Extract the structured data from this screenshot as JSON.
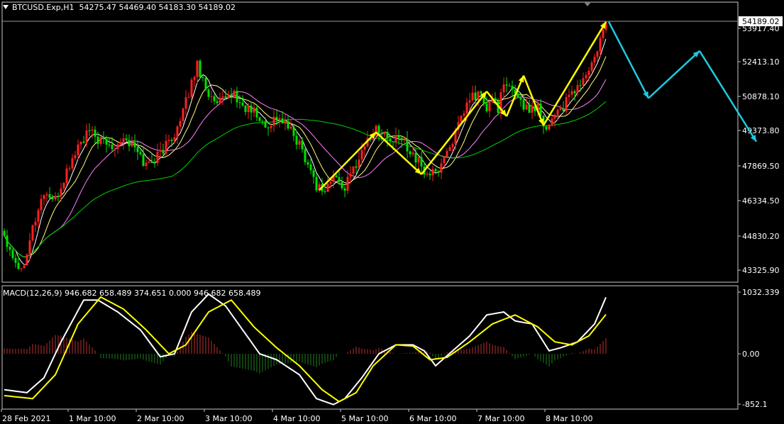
{
  "header": {
    "symbol": "BTCUSD.Exp,H1",
    "ohlc": "54275.47 54469.40 54183.30 54189.02"
  },
  "macd_header": {
    "text": "MACD(12,26,9) 946.682 658.489 374.651 0.000 946.682 658.489"
  },
  "price_axis": {
    "ticks": [
      53917.4,
      52413.1,
      50878.1,
      49373.8,
      47869.5,
      46334.5,
      44830.2,
      43325.9
    ],
    "tick_labels": [
      "53917.40",
      "52413.10",
      "50878.10",
      "49373.80",
      "47869.50",
      "46334.50",
      "44830.20",
      "43325.90"
    ],
    "current_price_label": "54189.02"
  },
  "macd_axis": {
    "tick_labels": [
      "1032.339",
      "0.00",
      "-852.1"
    ]
  },
  "time_axis": {
    "labels": [
      "28 Feb 2021",
      "1 Mar 10:00",
      "2 Mar 10:00",
      "3 Mar 10:00",
      "4 Mar 10:00",
      "5 Mar 10:00",
      "6 Mar 10:00",
      "7 Mar 10:00",
      "8 Mar 10:00"
    ]
  },
  "colors": {
    "background": "#000000",
    "bull": "#ff2020",
    "bear": "#00e000",
    "ma_fast": "#ffffff",
    "ma_mid": "#ffff80",
    "ma_slow": "#ff80ff",
    "ma_long": "#00d000",
    "zigzag": "#ffff00",
    "forecast": "#20c8e0",
    "macd_line": "#ffffff",
    "signal_line": "#ffff00",
    "hist_pos": "#c03030",
    "hist_neg": "#208020"
  },
  "chart_data": {
    "type": "candlestick",
    "symbol": "BTCUSD.Exp",
    "timeframe": "H1",
    "ylim": [
      42600,
      55000
    ],
    "close_path": [
      [
        0,
        44900
      ],
      [
        3,
        44000
      ],
      [
        6,
        43300
      ],
      [
        10,
        45200
      ],
      [
        14,
        46700
      ],
      [
        18,
        46300
      ],
      [
        22,
        47600
      ],
      [
        26,
        48700
      ],
      [
        30,
        49300
      ],
      [
        34,
        48900
      ],
      [
        38,
        48700
      ],
      [
        42,
        49100
      ],
      [
        46,
        48600
      ],
      [
        50,
        47900
      ],
      [
        54,
        48300
      ],
      [
        58,
        48900
      ],
      [
        62,
        49700
      ],
      [
        66,
        51500
      ],
      [
        68,
        52300
      ],
      [
        71,
        51300
      ],
      [
        74,
        50500
      ],
      [
        78,
        50700
      ],
      [
        80,
        51100
      ],
      [
        84,
        50400
      ],
      [
        88,
        50200
      ],
      [
        92,
        49500
      ],
      [
        96,
        50000
      ],
      [
        100,
        49500
      ],
      [
        104,
        48800
      ],
      [
        107,
        48000
      ],
      [
        110,
        47000
      ],
      [
        113,
        46800
      ],
      [
        116,
        47400
      ],
      [
        120,
        46900
      ],
      [
        124,
        48000
      ],
      [
        128,
        49000
      ],
      [
        132,
        49500
      ],
      [
        136,
        48900
      ],
      [
        140,
        49000
      ],
      [
        144,
        48400
      ],
      [
        148,
        47600
      ],
      [
        152,
        47500
      ],
      [
        156,
        48500
      ],
      [
        160,
        49500
      ],
      [
        164,
        50800
      ],
      [
        168,
        51000
      ],
      [
        170,
        50100
      ],
      [
        172,
        50900
      ],
      [
        174,
        50400
      ],
      [
        176,
        51300
      ],
      [
        180,
        51100
      ],
      [
        184,
        50300
      ],
      [
        188,
        50500
      ],
      [
        191,
        49400
      ],
      [
        194,
        50200
      ],
      [
        197,
        50400
      ],
      [
        200,
        51000
      ],
      [
        204,
        51600
      ],
      [
        208,
        52500
      ],
      [
        212,
        54200
      ]
    ],
    "zigzag": [
      [
        111,
        46800
      ],
      [
        131,
        49300
      ],
      [
        147,
        47500
      ],
      [
        170,
        51100
      ],
      [
        177,
        50000
      ],
      [
        183,
        51800
      ],
      [
        190,
        49600
      ],
      [
        212,
        54300
      ]
    ],
    "forecast": [
      [
        213,
        54300
      ],
      [
        227,
        50800
      ],
      [
        245,
        52900
      ],
      [
        265,
        48900
      ]
    ],
    "macd": {
      "params": "12,26,9",
      "values": {
        "macd": 946.682,
        "signal": 658.489,
        "histogram": 374.651
      },
      "macd_path": [
        [
          0,
          -600
        ],
        [
          8,
          -650
        ],
        [
          14,
          -400
        ],
        [
          20,
          200
        ],
        [
          28,
          900
        ],
        [
          33,
          900
        ],
        [
          40,
          700
        ],
        [
          48,
          400
        ],
        [
          55,
          -50
        ],
        [
          60,
          0
        ],
        [
          66,
          700
        ],
        [
          72,
          1000
        ],
        [
          78,
          800
        ],
        [
          84,
          400
        ],
        [
          90,
          0
        ],
        [
          96,
          -100
        ],
        [
          104,
          -350
        ],
        [
          110,
          -750
        ],
        [
          116,
          -850
        ],
        [
          120,
          -750
        ],
        [
          126,
          -400
        ],
        [
          132,
          0
        ],
        [
          138,
          150
        ],
        [
          144,
          150
        ],
        [
          148,
          50
        ],
        [
          152,
          -200
        ],
        [
          158,
          50
        ],
        [
          164,
          300
        ],
        [
          170,
          650
        ],
        [
          176,
          700
        ],
        [
          180,
          550
        ],
        [
          186,
          500
        ],
        [
          192,
          50
        ],
        [
          196,
          100
        ],
        [
          202,
          200
        ],
        [
          208,
          500
        ],
        [
          212,
          946
        ]
      ],
      "signal_path": [
        [
          0,
          -700
        ],
        [
          10,
          -750
        ],
        [
          18,
          -350
        ],
        [
          26,
          500
        ],
        [
          34,
          950
        ],
        [
          42,
          750
        ],
        [
          50,
          400
        ],
        [
          58,
          0
        ],
        [
          64,
          150
        ],
        [
          72,
          700
        ],
        [
          80,
          900
        ],
        [
          88,
          450
        ],
        [
          96,
          100
        ],
        [
          104,
          -200
        ],
        [
          112,
          -600
        ],
        [
          118,
          -800
        ],
        [
          124,
          -650
        ],
        [
          130,
          -200
        ],
        [
          138,
          150
        ],
        [
          144,
          130
        ],
        [
          150,
          -100
        ],
        [
          156,
          -60
        ],
        [
          164,
          200
        ],
        [
          172,
          500
        ],
        [
          180,
          650
        ],
        [
          188,
          450
        ],
        [
          194,
          200
        ],
        [
          200,
          150
        ],
        [
          206,
          300
        ],
        [
          212,
          658
        ]
      ]
    }
  }
}
